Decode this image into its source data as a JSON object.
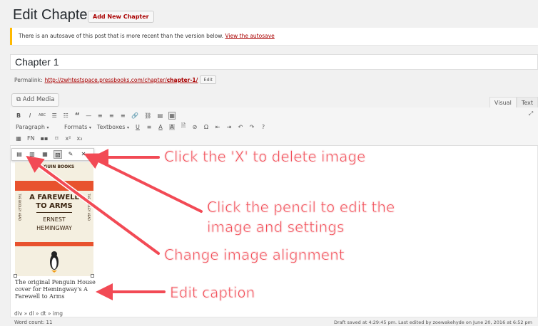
{
  "header": {
    "title": "Edit Chapter",
    "add_new": "Add New Chapter"
  },
  "notice": {
    "text": "There is an autosave of this post that is more recent than the version below.",
    "link": "View the autosave"
  },
  "post": {
    "title": "Chapter 1",
    "permalink_label": "Permalink:",
    "permalink_url": "http://zwhtestspace.pressbooks.com/chapter/",
    "permalink_slug": "chapter-1/",
    "edit_label": "Edit"
  },
  "media": {
    "add_media": "Add Media"
  },
  "tabs": [
    "Visual",
    "Text"
  ],
  "toolbar": {
    "row1": [
      "B",
      "I",
      "ABC",
      "☰",
      "☷",
      "“",
      "—",
      "≡",
      "≡",
      "≡",
      "🔗",
      "⛓",
      "▤",
      "▦"
    ],
    "format_select": "Paragraph",
    "formats": "Formats",
    "textboxes": "Textboxes",
    "row2_icons": [
      "U",
      "≡",
      "A",
      "A",
      "🗎",
      "⊘",
      "Ω",
      "⇤",
      "⇥",
      "↶",
      "↷",
      "?"
    ],
    "row3": [
      "▦",
      "FN",
      "▪▪",
      "⌑",
      "x²",
      "x₂"
    ],
    "expand": "⤢"
  },
  "image_toolbar": {
    "icons": [
      "align-left-icon",
      "align-center-icon",
      "align-right-icon",
      "align-none-icon",
      "pencil-icon",
      "close-icon"
    ],
    "glyphs": [
      "▤",
      "▥",
      "▦",
      "▧",
      "✎",
      "✕"
    ]
  },
  "cover": {
    "publisher": "PENGUIN BOOKS",
    "title_line1": "A FAREWELL",
    "title_line2": "TO ARMS",
    "author_line1": "ERNEST",
    "author_line2": "HEMINGWAY",
    "side_left": "THE BODLEY HEAD",
    "side_right": "THE BODLEY HEAD"
  },
  "caption": "The original Penguin House cover for Hemingway's A Farewell to Arms",
  "status": {
    "path": "div » dl » dt » img",
    "word_count": "Word count: 11",
    "draft": "Draft saved at 4:29:45 pm. Last edited by zoewakehyde on June 20, 2016 at 6:52 pm"
  },
  "annotations": {
    "delete": "Click the 'X' to delete image",
    "pencil_line1": "Click the pencil to edit the",
    "pencil_line2": "image and settings",
    "alignment": "Change image alignment",
    "caption": "Edit caption"
  },
  "colors": {
    "annotation": "#f24a55",
    "accent": "#a00",
    "cover": "#e8522e"
  }
}
